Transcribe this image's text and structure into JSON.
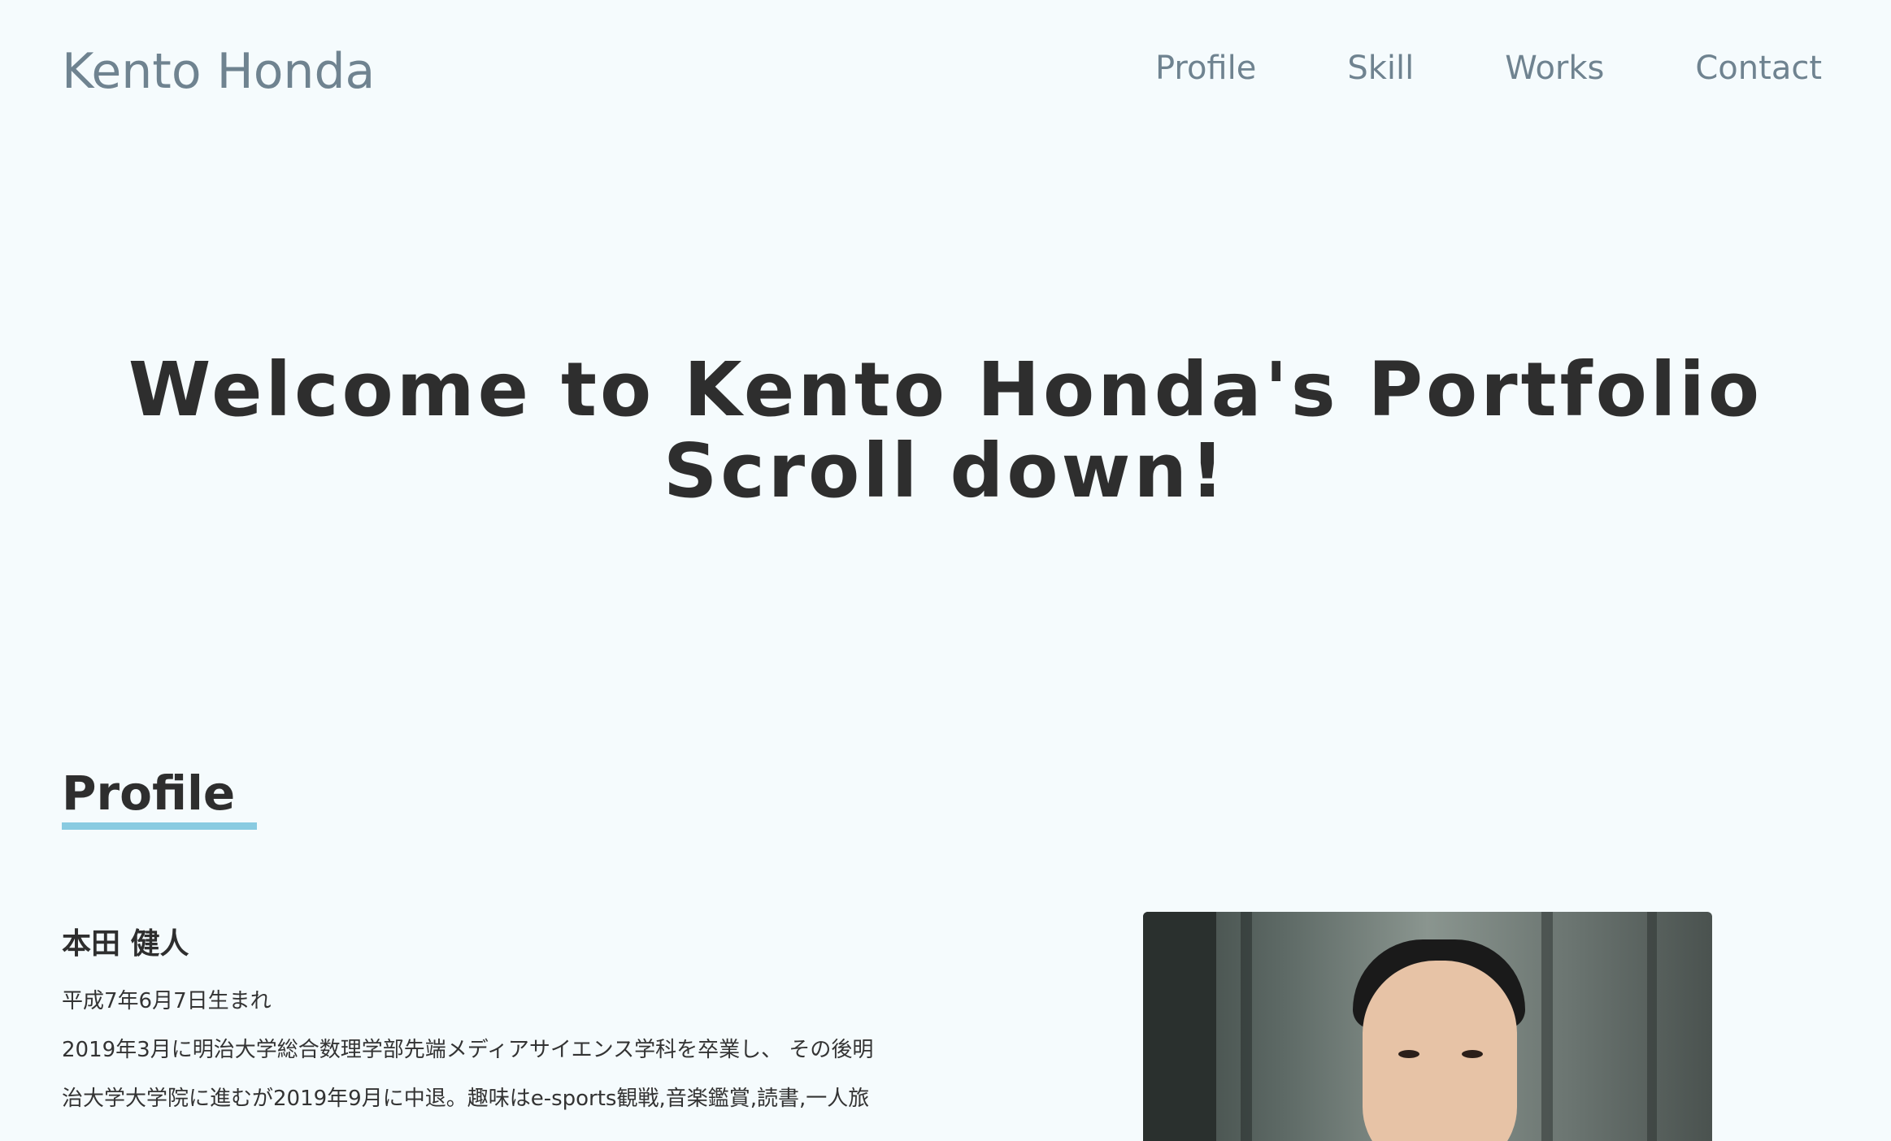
{
  "header": {
    "logo_text": "Kento Honda",
    "nav": [
      {
        "label": "Profile"
      },
      {
        "label": "Skill"
      },
      {
        "label": "Works"
      },
      {
        "label": "Contact"
      }
    ]
  },
  "hero": {
    "line1": "Welcome to Kento Honda's Portfolio",
    "line2": "Scroll down!"
  },
  "profile": {
    "section_title": "Profile",
    "name": "本田 健人",
    "paragraphs": [
      "平成7年6月7日生まれ",
      "2019年3月に明治大学総合数理学部先端メディアサイエンス学科を卒業し、 その後明",
      "治大学大学院に進むが2019年9月に中退。趣味はe-sports観戦,音楽鑑賞,読書,一人旅"
    ],
    "photo_icon": "portrait-photo"
  },
  "colors": {
    "background": "#f5fbfd",
    "nav_text": "#6f8390",
    "heading_text": "#2e2e2e",
    "accent_underline": "#89cbe1"
  }
}
